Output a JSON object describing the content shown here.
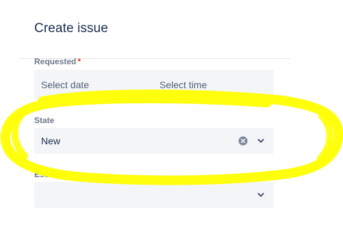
{
  "dialog": {
    "title": "Create issue"
  },
  "fields": {
    "requested": {
      "label": "Requested",
      "required_marker": "*",
      "date_placeholder": "Select date",
      "time_placeholder": "Select time"
    },
    "state": {
      "label": "State",
      "value": "New"
    },
    "escalate": {
      "label": "Escalate",
      "value": ""
    }
  },
  "icons": {
    "clear": "clear-icon",
    "chevron": "chevron-down-icon"
  },
  "colors": {
    "highlight": "#ffff00",
    "required": "#de350b",
    "field_background": "#f4f5f7",
    "text": "#172b4d"
  }
}
